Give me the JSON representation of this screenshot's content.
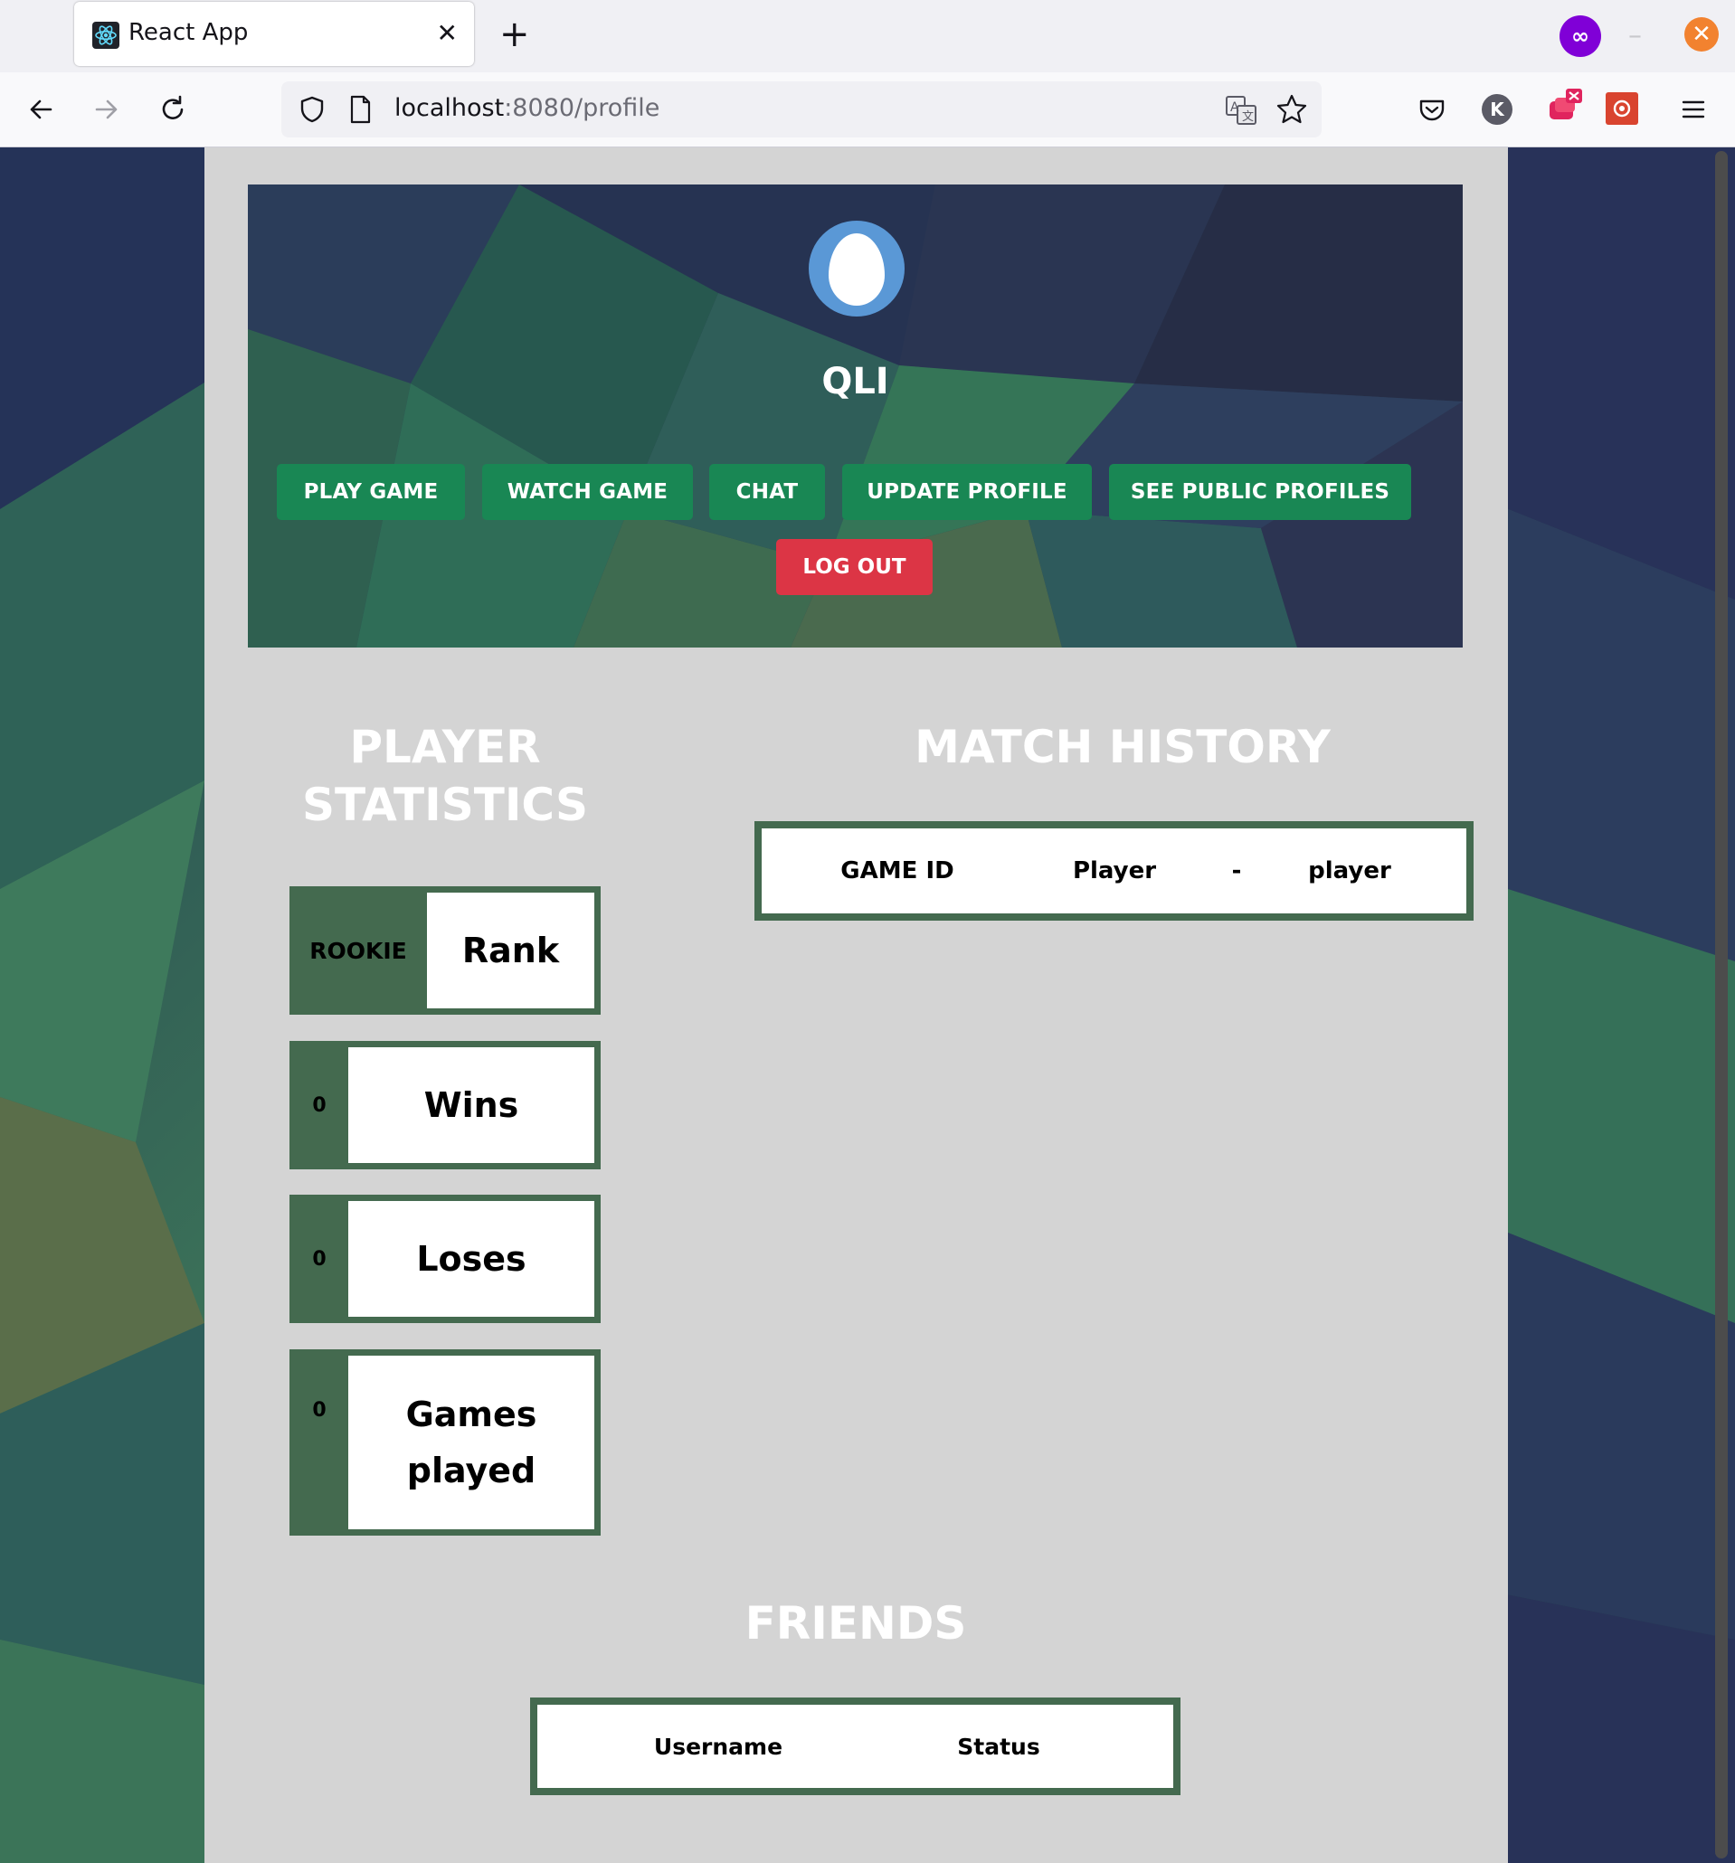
{
  "browser": {
    "tab_title": "React App",
    "url_host": "localhost",
    "url_rest": ":8080/profile",
    "account_initial": "K"
  },
  "profile": {
    "username": "QLI",
    "buttons": {
      "play_game": "PLAY GAME",
      "watch_game": "WATCH GAME",
      "chat": "CHAT",
      "update_profile": "UPDATE PROFILE",
      "see_public_profiles": "SEE PUBLIC PROFILES",
      "log_out": "LOG OUT"
    }
  },
  "stats": {
    "title_line1": "PLAYER",
    "title_line2": "STATISTICS",
    "rank_value": "ROOKIE",
    "rank_label": "Rank",
    "wins_value": "0",
    "wins_label": "Wins",
    "loses_value": "0",
    "loses_label": "Loses",
    "games_value": "0",
    "games_label_line1": "Games",
    "games_label_line2": "played"
  },
  "match_history": {
    "title": "MATCH HISTORY",
    "headers": [
      "GAME ID",
      "Player",
      "-",
      "player"
    ]
  },
  "friends": {
    "title": "FRIENDS",
    "headers": [
      "Username",
      "Status"
    ]
  },
  "colors": {
    "primary_button": "#198754",
    "danger_button": "#dc3545",
    "stat_border": "#446a4f",
    "page_panel": "#d4d4d4"
  }
}
